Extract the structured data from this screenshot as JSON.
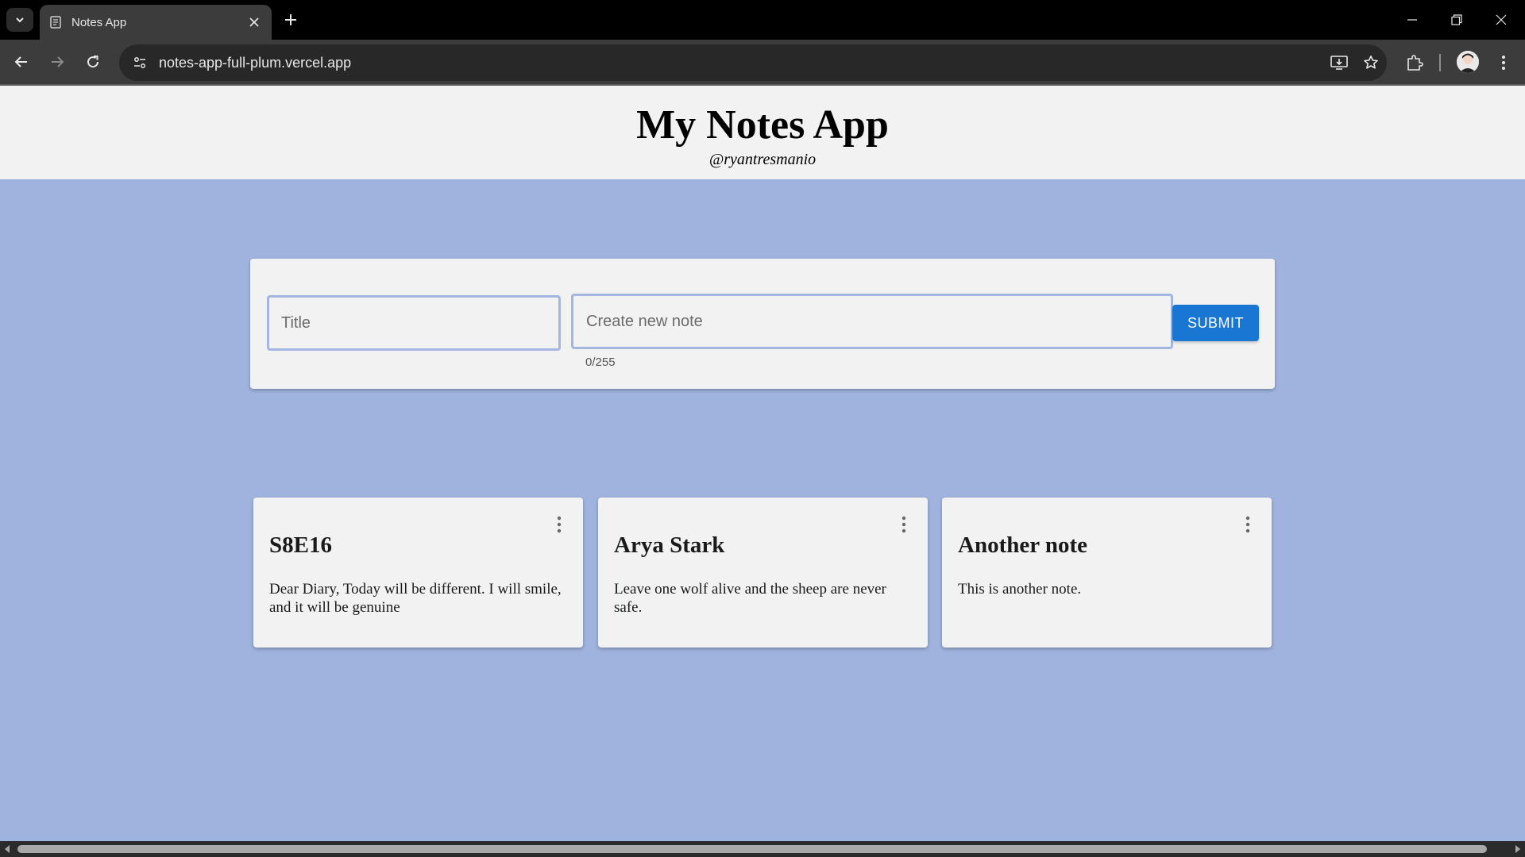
{
  "browser": {
    "tab_title": "Notes App",
    "url": "notes-app-full-plum.vercel.app",
    "icons": [
      "tab-search-icon",
      "notes-favicon-icon",
      "close-icon",
      "plus-icon",
      "minimize-icon",
      "restore-icon",
      "window-close-icon",
      "back-icon",
      "forward-icon",
      "reload-icon",
      "site-info-icon",
      "install-app-icon",
      "bookmark-star-icon",
      "extensions-icon",
      "kebab-menu-icon"
    ]
  },
  "header": {
    "title": "My Notes App",
    "subtitle": "@ryantresmanio"
  },
  "form": {
    "title_placeholder": "Title",
    "title_value": "",
    "note_placeholder": "Create new note",
    "note_value": "",
    "char_count": "0/255",
    "submit_label": "SUBMIT"
  },
  "notes": [
    {
      "title": "S8E16",
      "body": "Dear Diary, Today will be different. I will smile, and it will be genuine"
    },
    {
      "title": "Arya Stark",
      "body": "Leave one wolf alive and the sheep are never safe."
    },
    {
      "title": "Another note",
      "body": "This is another note."
    }
  ],
  "colors": {
    "page_background": "#a0b3de",
    "card_background": "#f2f2f2",
    "input_border": "#a3b6df",
    "submit_button": "#1976d2"
  }
}
